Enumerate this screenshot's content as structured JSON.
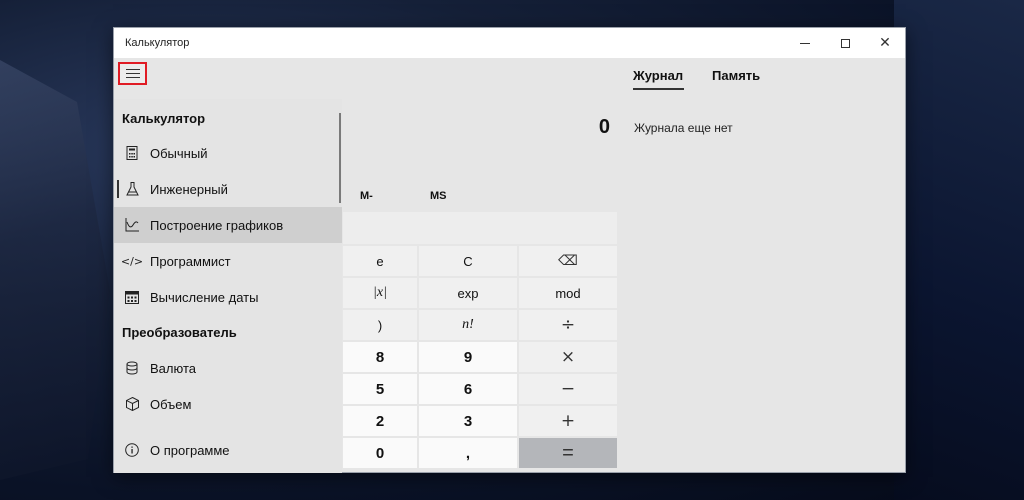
{
  "window": {
    "title": "Калькулятор"
  },
  "nav": {
    "heading_calc": "Калькулятор",
    "items": [
      {
        "label": "Обычный",
        "icon": "calculator-icon"
      },
      {
        "label": "Инженерный",
        "icon": "flask-icon"
      },
      {
        "label": "Построение графиков",
        "icon": "graph-icon"
      },
      {
        "label": "Программист",
        "icon": "code-icon"
      },
      {
        "label": "Вычисление даты",
        "icon": "calendar-icon"
      }
    ],
    "heading_conv": "Преобразователь",
    "conv_items": [
      {
        "label": "Валюта",
        "icon": "currency-icon"
      },
      {
        "label": "Объем",
        "icon": "cube-icon"
      }
    ],
    "about": "О программе"
  },
  "display": {
    "value": "0"
  },
  "memory": {
    "m_minus": "M-",
    "ms": "MS"
  },
  "keys": {
    "e": "e",
    "c": "C",
    "back": "⌫",
    "abs": "|x|",
    "exp": "exp",
    "mod": "mod",
    "rparen": ")",
    "fact": "n!",
    "div": "÷",
    "k8": "8",
    "k9": "9",
    "mul": "×",
    "k5": "5",
    "k6": "6",
    "sub": "−",
    "k2": "2",
    "k3": "3",
    "add": "+",
    "k0": "0",
    "comma": ",",
    "eq": "="
  },
  "history": {
    "tab_journal": "Журнал",
    "tab_memory": "Память",
    "empty": "Журнала еще нет"
  },
  "colors": {
    "selected_nav": "#cfcfcf",
    "equals_key": "#b4b6ba",
    "highlight": "#e01b24"
  }
}
